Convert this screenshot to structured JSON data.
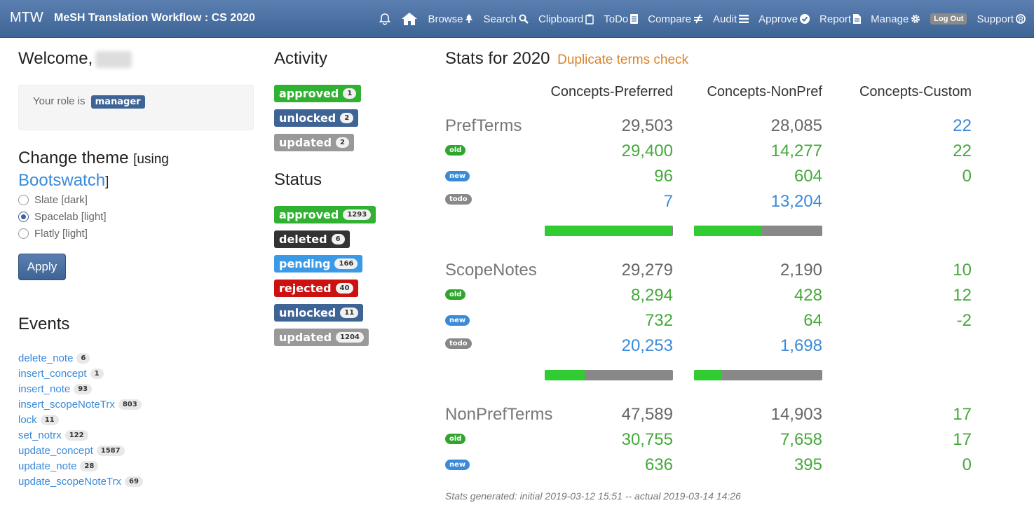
{
  "navbar": {
    "brand": "MTW",
    "title": "MeSH Translation Workflow : CS 2020",
    "items": [
      {
        "label": "Browse",
        "icon": "tree-icon"
      },
      {
        "label": "Search",
        "icon": "search-icon"
      },
      {
        "label": "Clipboard",
        "icon": "clipboard-icon"
      },
      {
        "label": "ToDo",
        "icon": "list-doc-icon"
      },
      {
        "label": "Compare",
        "icon": "not-equal-icon"
      },
      {
        "label": "Audit",
        "icon": "menu-icon"
      },
      {
        "label": "Approve",
        "icon": "check-circle-icon"
      },
      {
        "label": "Report",
        "icon": "file-icon"
      },
      {
        "label": "Manage",
        "icon": "gear-icon"
      }
    ],
    "logout": "Log Out",
    "support": "Support"
  },
  "welcome": {
    "text": "Welcome,"
  },
  "role": {
    "prefix": "Your role is",
    "value": "manager"
  },
  "theme": {
    "title": "Change theme",
    "using_open": "[using",
    "link": "Bootswatch",
    "using_close": "]",
    "options": [
      {
        "label": "Slate [dark]",
        "checked": false
      },
      {
        "label": "Spacelab [light]",
        "checked": true
      },
      {
        "label": "Flatly [light]",
        "checked": false
      }
    ],
    "apply": "Apply"
  },
  "events": {
    "title": "Events",
    "items": [
      {
        "name": "delete_note",
        "count": "6"
      },
      {
        "name": "insert_concept",
        "count": "1"
      },
      {
        "name": "insert_note",
        "count": "93"
      },
      {
        "name": "insert_scopeNoteTrx",
        "count": "803"
      },
      {
        "name": "lock",
        "count": "11"
      },
      {
        "name": "set_notrx",
        "count": "122"
      },
      {
        "name": "update_concept",
        "count": "1587"
      },
      {
        "name": "update_note",
        "count": "28"
      },
      {
        "name": "update_scopeNoteTrx",
        "count": "69"
      }
    ]
  },
  "activity": {
    "title": "Activity",
    "items": [
      {
        "label": "approved",
        "count": "1",
        "color": "#31b131"
      },
      {
        "label": "unlocked",
        "count": "2",
        "color": "#3e6496"
      },
      {
        "label": "updated",
        "count": "2",
        "color": "#999999"
      }
    ]
  },
  "status": {
    "title": "Status",
    "items": [
      {
        "label": "approved",
        "count": "1293",
        "color": "#31b131"
      },
      {
        "label": "deleted",
        "count": "6",
        "color": "#333333"
      },
      {
        "label": "pending",
        "count": "166",
        "color": "#3a9ae8"
      },
      {
        "label": "rejected",
        "count": "40",
        "color": "#cc1111"
      },
      {
        "label": "unlocked",
        "count": "11",
        "color": "#3e6496"
      },
      {
        "label": "updated",
        "count": "1204",
        "color": "#999999"
      }
    ]
  },
  "stats": {
    "title": "Stats for 2020",
    "dup_link": "Duplicate terms check",
    "columns": [
      "Concepts-Preferred",
      "Concepts-NonPref",
      "Concepts-Custom"
    ],
    "badges": {
      "old": "old",
      "new": "new",
      "todo": "todo"
    },
    "pref": {
      "label": "PrefTerms",
      "total": [
        "29,503",
        "28,085",
        "22"
      ],
      "old": [
        "29,400",
        "14,277",
        "22"
      ],
      "new": [
        "96",
        "604",
        "0"
      ],
      "todo": [
        "7",
        "13,204",
        ""
      ],
      "progress": [
        0.99,
        0.53
      ]
    },
    "scope": {
      "label": "ScopeNotes",
      "total": [
        "29,279",
        "2,190",
        "10"
      ],
      "old": [
        "8,294",
        "428",
        "12"
      ],
      "new": [
        "732",
        "64",
        "-2"
      ],
      "todo": [
        "20,253",
        "1,698",
        ""
      ],
      "progress": [
        0.31,
        0.22
      ]
    },
    "nonpref": {
      "label": "NonPrefTerms",
      "total": [
        "47,589",
        "14,903",
        "17"
      ],
      "old": [
        "30,755",
        "7,658",
        "17"
      ],
      "new": [
        "636",
        "395",
        "0"
      ]
    },
    "footer": "Stats generated: initial 2019-03-12 15:51 -- actual 2019-03-14 14:26"
  }
}
